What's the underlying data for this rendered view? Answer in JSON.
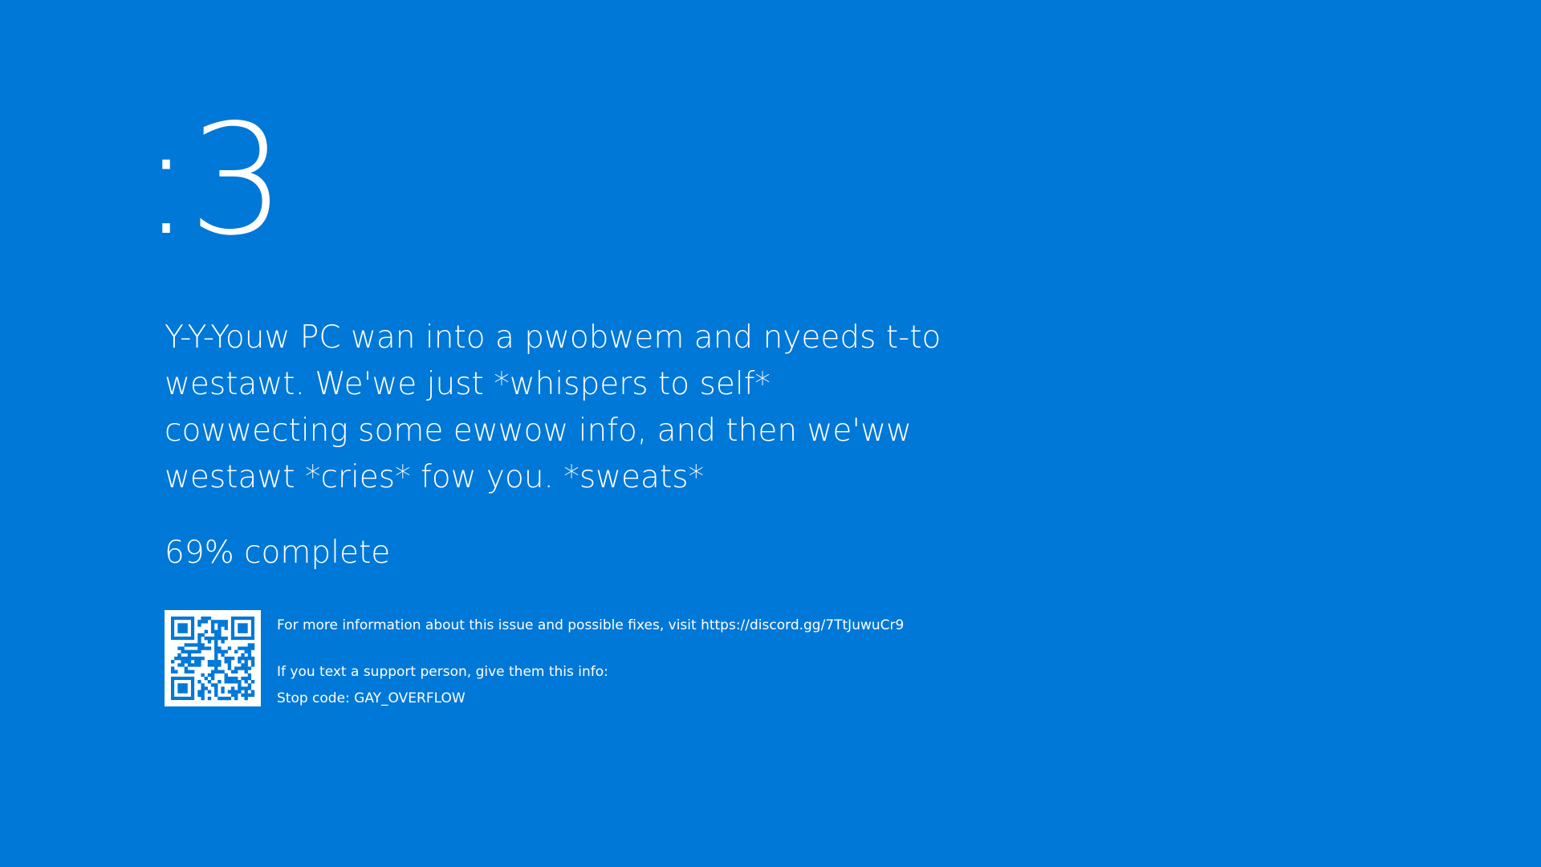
{
  "screen": {
    "face": ":3",
    "message": "Y-Y-Youw PC wan into a pwobwem and nyeeds t-to westawt. We'we just *whispers to self* cowwecting some ewwow info, and then we'ww westawt *cries* fow you. *sweats*",
    "progress_label": "69% complete",
    "info": {
      "more_info": "For more information about this issue and possible fixes, visit https://discord.gg/7TtJuwuCr9",
      "support_prompt": "If you text a support person, give them this info:",
      "stop_code": "Stop code: GAY_OVERFLOW"
    },
    "qr_icon": "qr-code-icon",
    "colors": {
      "background": "#0078d7",
      "foreground": "#ffffff"
    }
  }
}
